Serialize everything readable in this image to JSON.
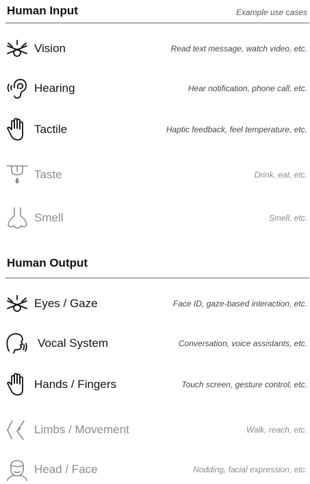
{
  "input": {
    "title": "Human Input",
    "subtitle": "Example use cases",
    "rows": [
      {
        "label": "Vision",
        "example": "Read text message, watch video, etc.",
        "icon": "eye-icon"
      },
      {
        "label": "Hearing",
        "example": "Hear notification, phone call, etc.",
        "icon": "ear-icon"
      },
      {
        "label": "Tactile",
        "example": "Haptic feedback, feel temperature, etc.",
        "icon": "hand-icon"
      },
      {
        "label": "Taste",
        "example": "Drink, eat, etc.",
        "icon": "tongue-icon"
      },
      {
        "label": "Smell",
        "example": "Smell, etc.",
        "icon": "nose-icon"
      }
    ]
  },
  "output": {
    "title": "Human Output",
    "rows": [
      {
        "label": "Eyes / Gaze",
        "example": "Face ID, gaze-based interaction, etc.",
        "icon": "eye-icon"
      },
      {
        "label": "Vocal System",
        "example": "Conversation, voice assistants, etc.",
        "icon": "speaking-head-icon"
      },
      {
        "label": "Hands / Fingers",
        "example": "Touch screen, gesture control, etc.",
        "icon": "hand-icon"
      },
      {
        "label": "Limbs / Movement",
        "example": "Walk, reach, etc.",
        "icon": "limbs-icon"
      },
      {
        "label": "Head / Face",
        "example": "Nodding, facial expression, etc.",
        "icon": "face-icon"
      }
    ]
  },
  "colors": {
    "dark_text": "#111111",
    "light_text": "#8c8c8c",
    "rule": "#666666"
  }
}
